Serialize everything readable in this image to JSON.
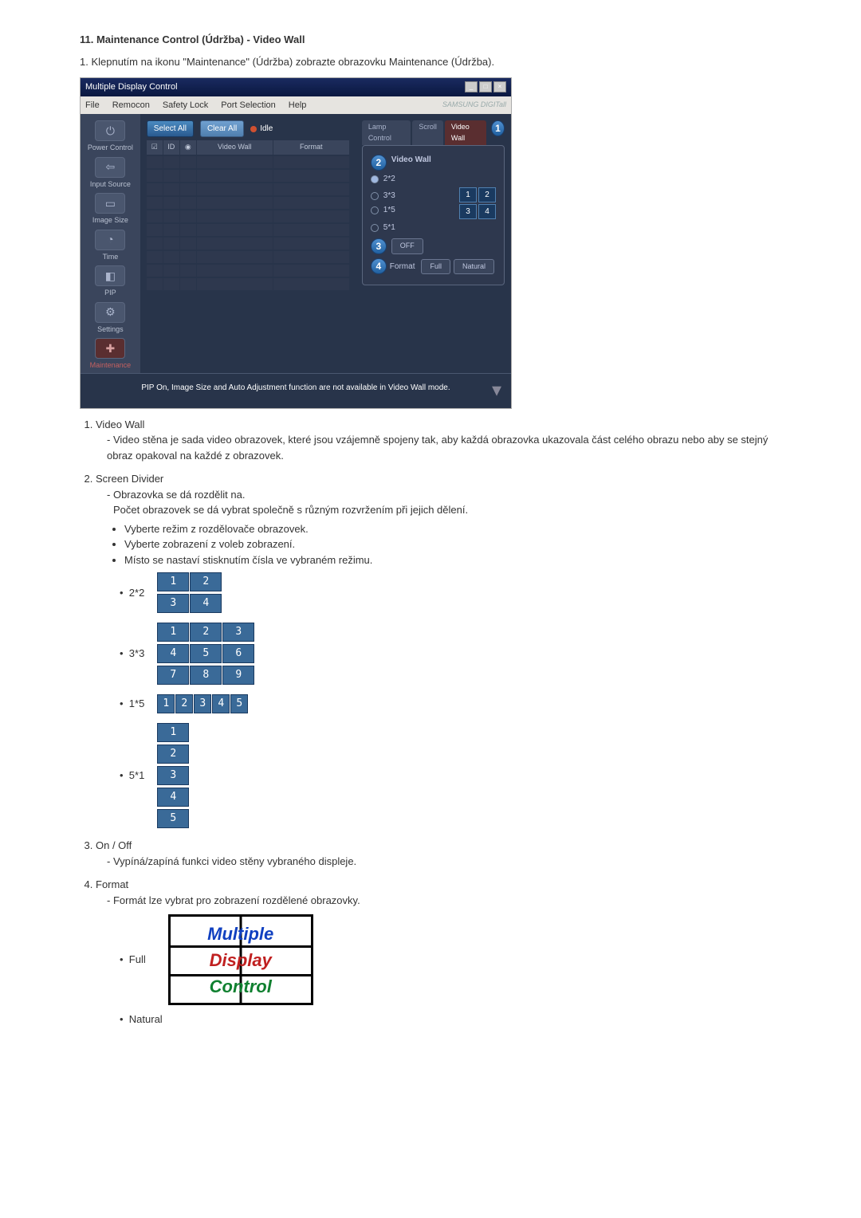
{
  "heading": "11. Maintenance Control (Údržba) - Video Wall",
  "intro": "1.  Klepnutím na ikonu \"Maintenance\" (Údržba) zobrazte obrazovku Maintenance (Údržba).",
  "app": {
    "title": "Multiple Display Control",
    "menubar": [
      "File",
      "Remocon",
      "Safety Lock",
      "Port Selection",
      "Help"
    ],
    "brand": "SAMSUNG DIGITall",
    "sidebar": {
      "power": "Power Control",
      "input": "Input Source",
      "image": "Image Size",
      "time": "Time",
      "pip": "PIP",
      "settings": "Settings",
      "maint": "Maintenance"
    },
    "toolbar": {
      "select": "Select All",
      "clear": "Clear All",
      "idle": "Idle"
    },
    "grid": {
      "col_id": "ID",
      "col_video": "Video Wall",
      "col_format": "Format"
    },
    "tabs": {
      "lamp": "Lamp Control",
      "scroll": "Scroll",
      "video": "Video Wall"
    },
    "panel": {
      "title": "Video Wall",
      "r22": "2*2",
      "r33": "3*3",
      "r15": "1*5",
      "r51": "5*1",
      "off": "OFF",
      "format": "Format",
      "full": "Full",
      "natural": "Natural"
    },
    "badges": {
      "b1": "1",
      "b2": "2",
      "b3": "3",
      "b4": "4"
    },
    "status": "PIP On, Image Size and Auto Adjustment function are not available in Video Wall mode."
  },
  "list": {
    "i1_t": "Video Wall",
    "i1_d": "Video stěna je sada video obrazovek, které jsou vzájemně spojeny tak, aby každá obrazovka ukazovala část celého obrazu nebo aby se stejný obraz opakoval na každé z obrazovek.",
    "i2_t": "Screen Divider",
    "i2_d1": "Obrazovka se dá rozdělit na.",
    "i2_d2": "Počet obrazovek se dá vybrat společně s různým rozvržením při jejich dělení.",
    "i2_b1": "Vyberte režim z rozdělovače obrazovek.",
    "i2_b2": "Vyberte zobrazení z voleb zobrazení.",
    "i2_b3": "Místo se nastaví stisknutím čísla ve vybraném režimu.",
    "d22": "2*2",
    "d33": "3*3",
    "d15": "1*5",
    "d51": "5*1",
    "i3_t": "On / Off",
    "i3_d": "Vypíná/zapíná funkci video stěny vybraného displeje.",
    "i4_t": "Format",
    "i4_d": "Formát lze vybrat pro zobrazení rozdělené obrazovky.",
    "full": "Full",
    "natural": "Natural",
    "mdc1": "Multiple",
    "mdc2": "Display",
    "mdc3": "Control"
  }
}
